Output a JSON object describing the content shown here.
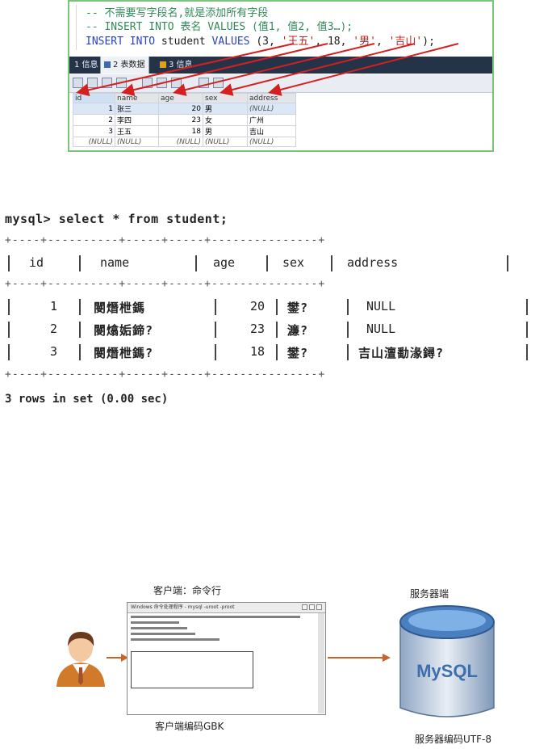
{
  "editor": {
    "line1": "-- 不需要写字段名,就是添加所有字段",
    "line2": "-- INSERT INTO 表名 VALUES (值1, 值2, 值3…);",
    "line3_kw1": "INSERT INTO",
    "line3_tbl": "student",
    "line3_kw2": "VALUES",
    "line3_open": "(3, ",
    "line3_v2": "'王五'",
    "line3_mid": ", 18, ",
    "line3_v4": "'男'",
    "line3_sep": ", ",
    "line3_v5": "'吉山'",
    "line3_close": ");"
  },
  "tabs": [
    {
      "label": "1 信息"
    },
    {
      "label": "2 表数据"
    },
    {
      "label": "3 信息"
    }
  ],
  "grid": {
    "columns": [
      "id",
      "name",
      "age",
      "sex",
      "address"
    ],
    "rows": [
      [
        "1",
        "张三",
        "20",
        "男",
        "(NULL)"
      ],
      [
        "2",
        "李四",
        "23",
        "女",
        "广州"
      ],
      [
        "3",
        "王五",
        "18",
        "男",
        "吉山"
      ],
      [
        "(NULL)",
        "(NULL)",
        "(NULL)",
        "(NULL)",
        "(NULL)"
      ]
    ]
  },
  "console": {
    "prompt": "mysql> select * from student;",
    "border": "+----+----------+-----+-----+---------------+",
    "header": [
      "id",
      "name",
      "age",
      "sex",
      "address"
    ],
    "rows": [
      [
        "1",
        "閿熸枻鎷",
        "20",
        "鐢?",
        "NULL"
      ],
      [
        "2",
        "閿熻姤鍗?",
        "23",
        "濂?",
        "NULL"
      ],
      [
        "3",
        "閿熸枻鎷?",
        "18",
        "鐢?",
        "吉山澶勫湪鐞?"
      ]
    ],
    "footer": "3 rows in set (0.00 sec)"
  },
  "diagram": {
    "client_label": "客户端：命令行",
    "server_label": "服务器端",
    "client_encoding": "客户端编码GBK",
    "server_encoding": "服务器编码UTF-8",
    "window_title": "Windows 命令处理程序 - mysql -uroot -proot",
    "mysql_logo": "MySQL"
  },
  "colors": {
    "arrow_red": "#d62020",
    "arrow_orange": "#c8642a",
    "tabbar_bg": "#253348",
    "cylinder_blue": "#4a7fc0"
  }
}
